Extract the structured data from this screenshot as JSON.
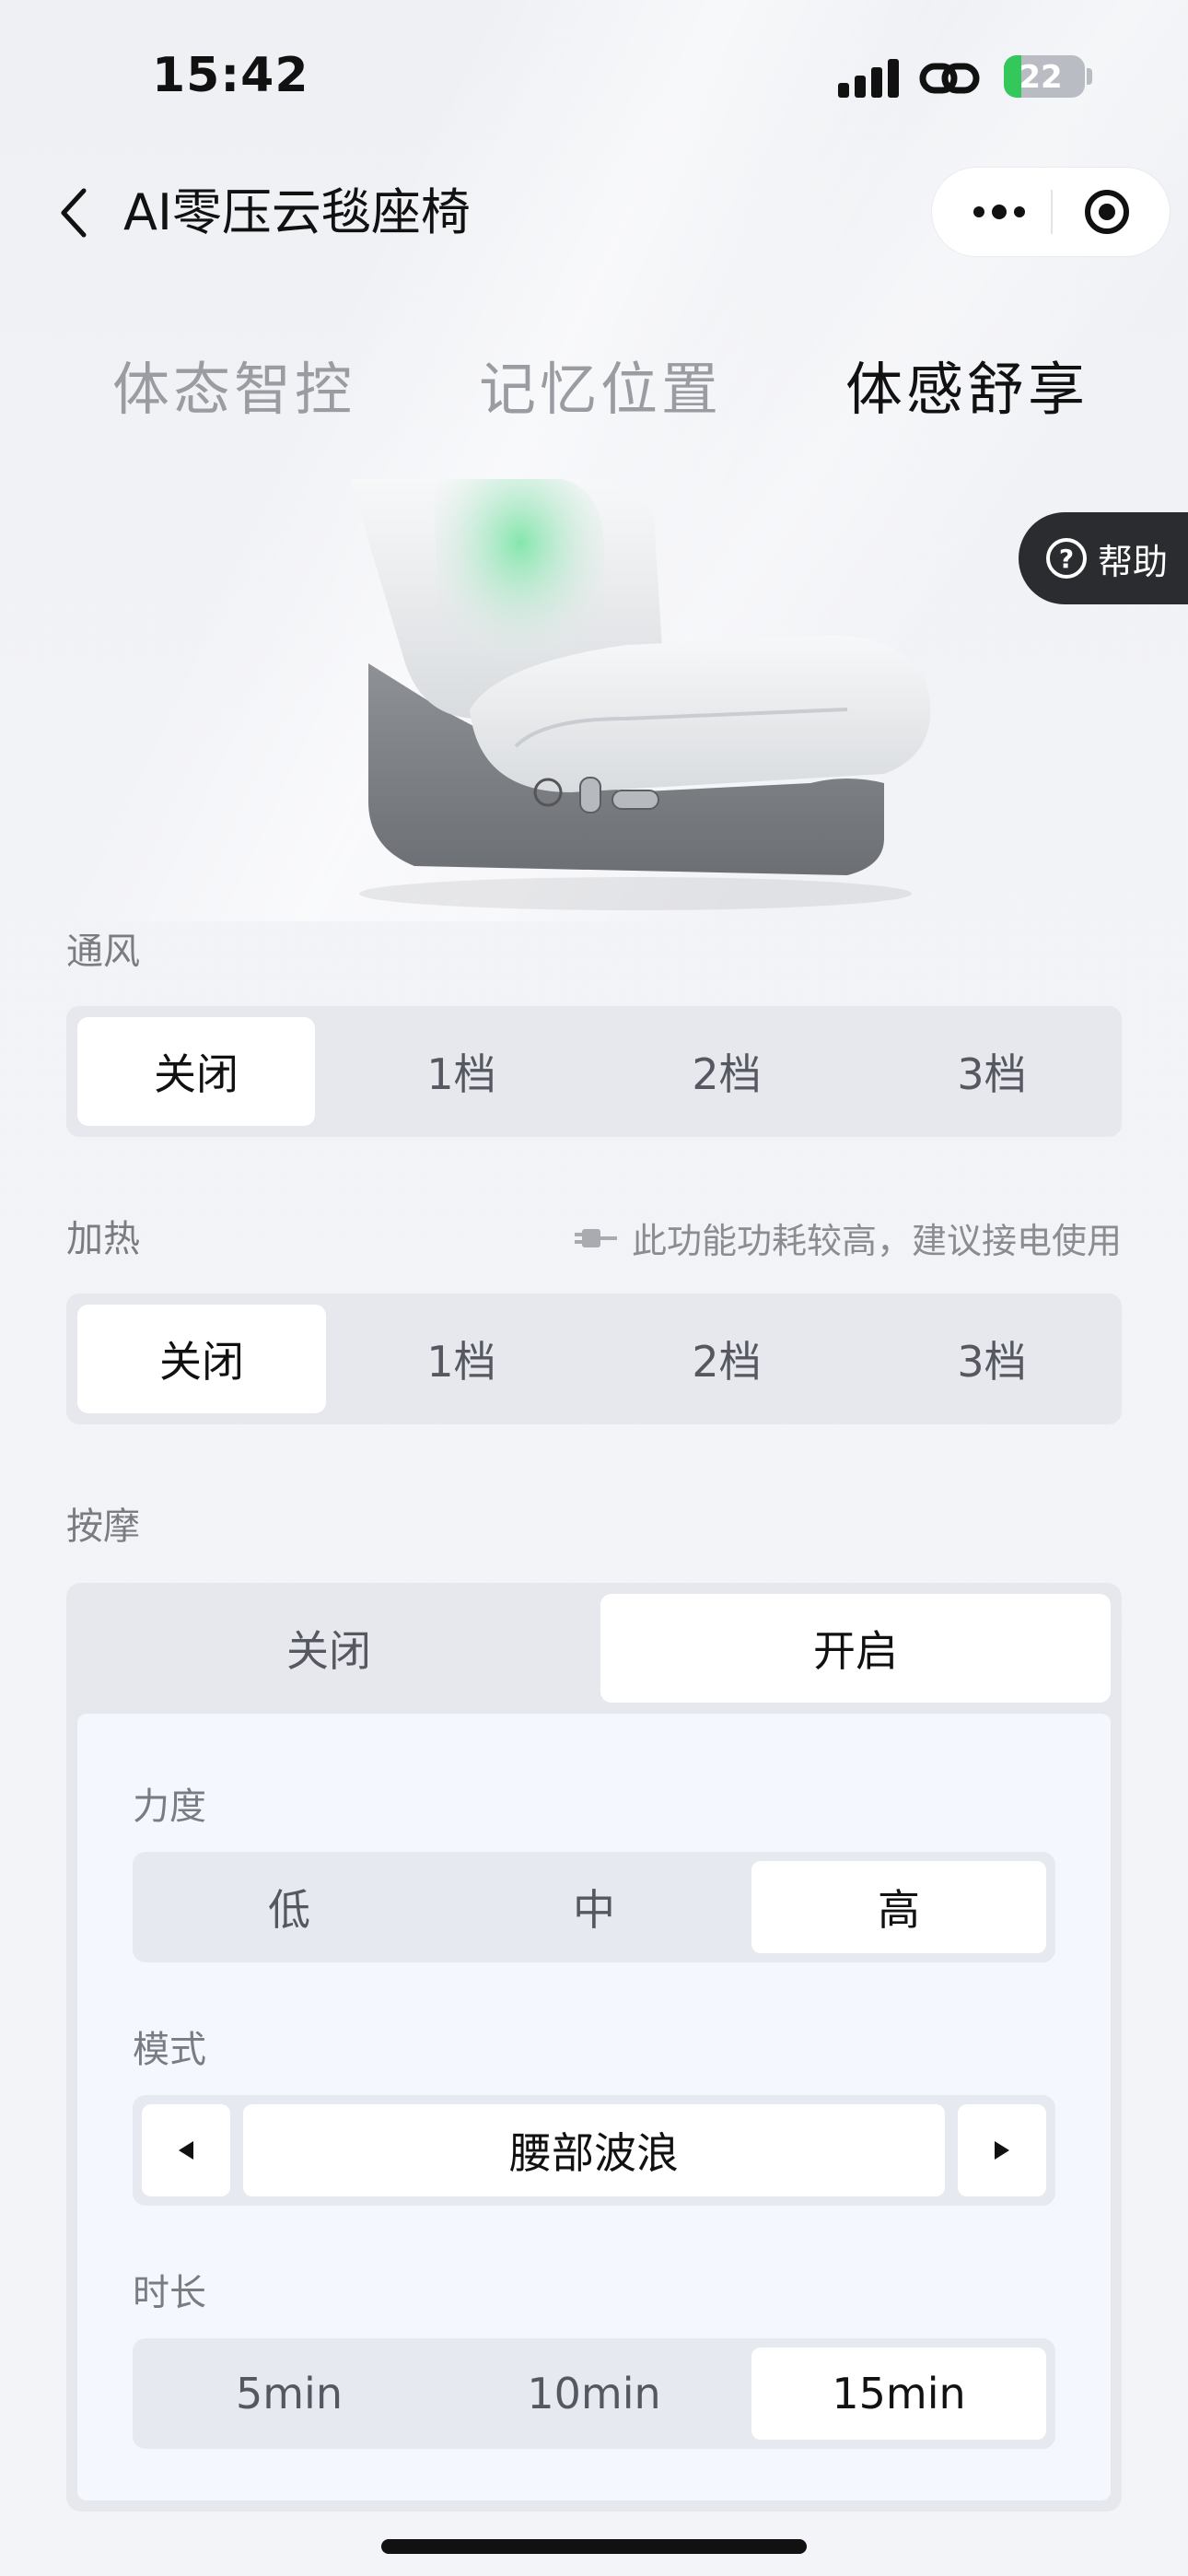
{
  "status_bar": {
    "time": "15:42",
    "battery": "22"
  },
  "nav": {
    "title": "AI零压云毯座椅"
  },
  "tabs": [
    {
      "label": "体态智控",
      "active": false
    },
    {
      "label": "记忆位置",
      "active": false
    },
    {
      "label": "体感舒享",
      "active": true
    }
  ],
  "help": {
    "label": "帮助"
  },
  "ventilation": {
    "label": "通风",
    "options": [
      "关闭",
      "1档",
      "2档",
      "3档"
    ],
    "selected": "关闭"
  },
  "heating": {
    "label": "加热",
    "notice": "此功能功耗较高，建议接电使用",
    "options": [
      "关闭",
      "1档",
      "2档",
      "3档"
    ],
    "selected": "关闭"
  },
  "massage": {
    "label": "按摩",
    "options": [
      "关闭",
      "开启"
    ],
    "selected": "开启",
    "intensity": {
      "label": "力度",
      "options": [
        "低",
        "中",
        "高"
      ],
      "selected": "高"
    },
    "mode": {
      "label": "模式",
      "value": "腰部波浪"
    },
    "duration": {
      "label": "时长",
      "options": [
        "5min",
        "10min",
        "15min"
      ],
      "selected": "15min"
    }
  },
  "colors": {
    "accent_green": "#34c759",
    "help_bg": "#2b2c30",
    "seat_glow": "#7ee6a8"
  }
}
